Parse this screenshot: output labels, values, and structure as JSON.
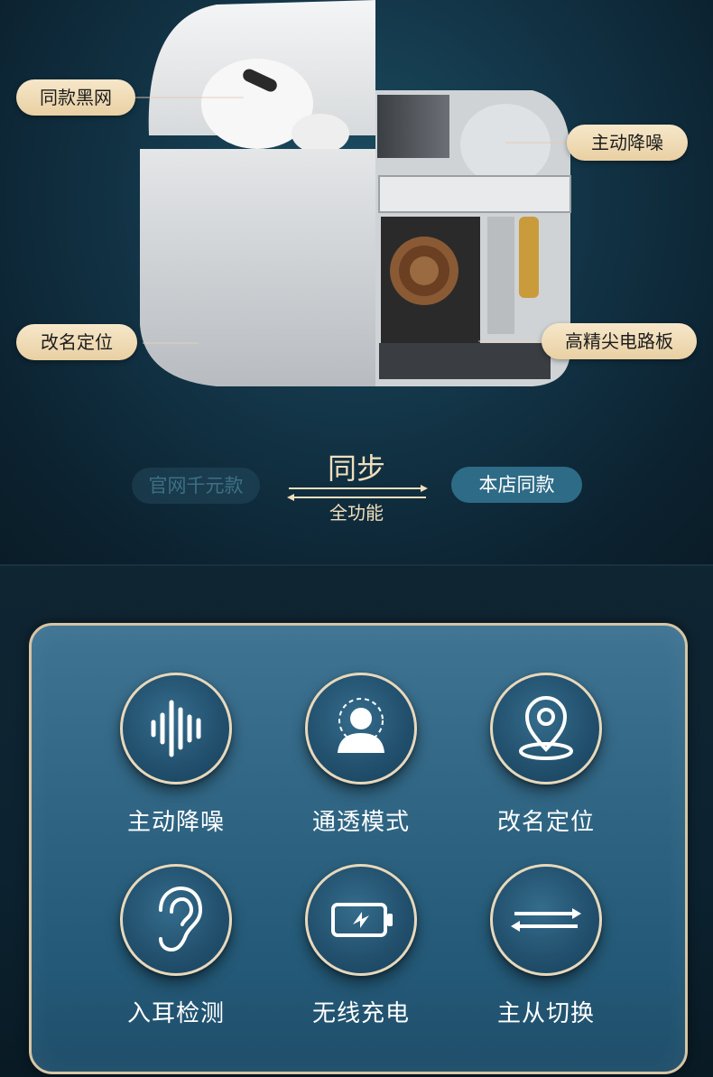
{
  "callouts": {
    "top_left": "同款黑网",
    "top_right": "主动降噪",
    "bottom_left": "改名定位",
    "bottom_right": "高精尖电路板"
  },
  "sync": {
    "left_pill": "官网千元款",
    "title": "同步",
    "subtitle": "全功能",
    "right_pill": "本店同款"
  },
  "features": [
    {
      "label": "主动降噪",
      "icon": "waveform-icon"
    },
    {
      "label": "通透模式",
      "icon": "person-icon"
    },
    {
      "label": "改名定位",
      "icon": "location-pin-icon"
    },
    {
      "label": "入耳检测",
      "icon": "ear-icon"
    },
    {
      "label": "无线充电",
      "icon": "battery-charging-icon"
    },
    {
      "label": "主从切换",
      "icon": "swap-arrows-icon"
    }
  ]
}
